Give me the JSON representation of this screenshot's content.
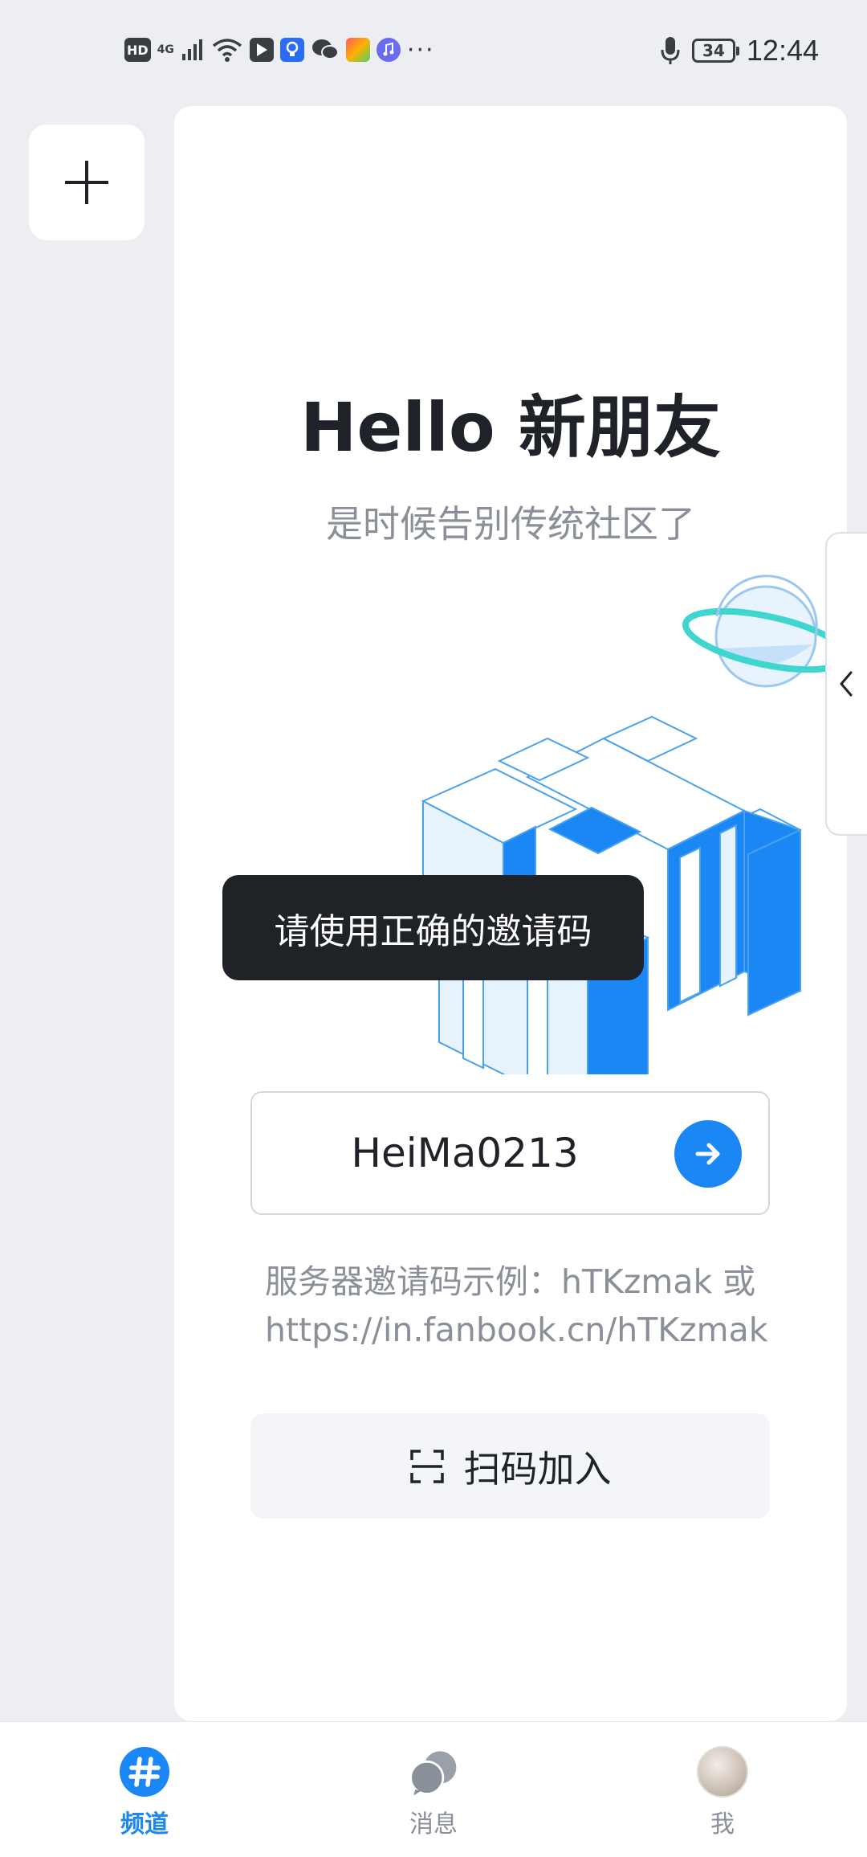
{
  "status_bar": {
    "hd_label": "HD",
    "network_label": "4G",
    "more_dots": "···",
    "battery_level": "34",
    "time": "12:44"
  },
  "card": {
    "title": "Hello 新朋友",
    "subtitle": "是时候告别传统社区了",
    "toast": "请使用正确的邀请码",
    "invite_input_value": "HeiMa0213",
    "hint_line1": "服务器邀请码示例：hTKzmak 或",
    "hint_line2": "https://in.fanbook.cn/hTKzmak",
    "scan_label": "扫码加入"
  },
  "bottom_nav": {
    "items": [
      {
        "label": "频道",
        "active": true,
        "icon": "hash-icon"
      },
      {
        "label": "消息",
        "active": false,
        "icon": "chat-bubbles-icon"
      },
      {
        "label": "我",
        "active": false,
        "icon": "avatar"
      }
    ]
  },
  "colors": {
    "accent": "#1b87f5",
    "toast_bg": "#1f2227",
    "page_bg": "#eceef1",
    "muted_text": "#8a8f99"
  }
}
